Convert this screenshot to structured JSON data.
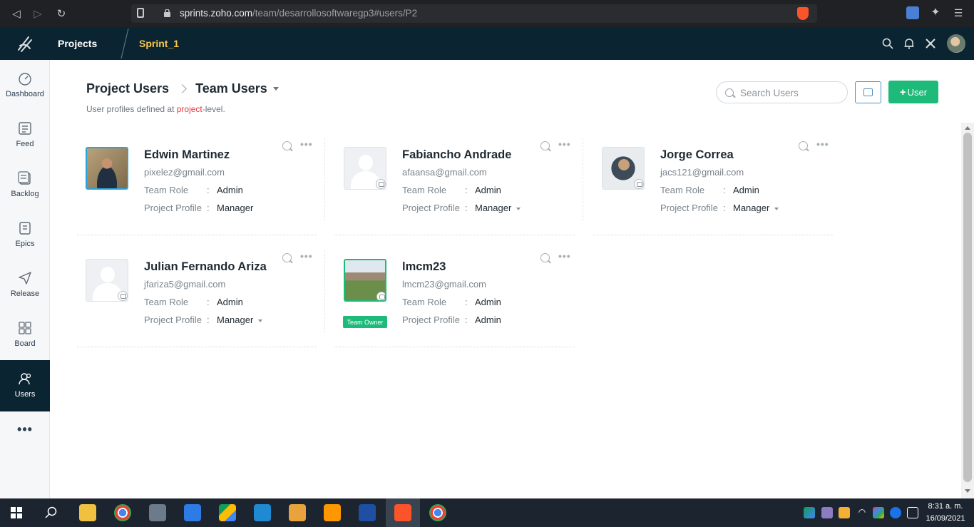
{
  "browser": {
    "url_host": "sprints.zoho.com",
    "url_path": "/team/desarrollosoftwaregp3#users/P2"
  },
  "header": {
    "projects_label": "Projects",
    "sprint_label": "Sprint_1"
  },
  "sidebar": {
    "items": [
      {
        "label": "Dashboard",
        "icon": "dashboard-icon"
      },
      {
        "label": "Feed",
        "icon": "feed-icon"
      },
      {
        "label": "Backlog",
        "icon": "backlog-icon"
      },
      {
        "label": "Epics",
        "icon": "epics-icon"
      },
      {
        "label": "Release",
        "icon": "release-icon"
      },
      {
        "label": "Board",
        "icon": "board-icon"
      },
      {
        "label": "Users",
        "icon": "users-icon",
        "active": true
      }
    ],
    "more": "•••"
  },
  "page": {
    "breadcrumb_1": "Project Users",
    "breadcrumb_2": "Team Users",
    "subtitle_pre": "User profiles defined at ",
    "subtitle_highlight": "project",
    "subtitle_post": "-level.",
    "search_placeholder": "Search Users",
    "add_user_label": "User"
  },
  "labels": {
    "team_role": "Team Role",
    "project_profile": "Project Profile",
    "colon": ":",
    "team_owner": "Team Owner"
  },
  "users": [
    {
      "name": "Edwin Martinez",
      "email": "pixelez@gmail.com",
      "team_role": "Admin",
      "project_profile": "Manager",
      "has_dropdown": false
    },
    {
      "name": "Fabiancho Andrade",
      "email": "afaansa@gmail.com",
      "team_role": "Admin",
      "project_profile": "Manager",
      "has_dropdown": true
    },
    {
      "name": "Jorge Correa",
      "email": "jacs121@gmail.com",
      "team_role": "Admin",
      "project_profile": "Manager",
      "has_dropdown": true
    },
    {
      "name": "Julian Fernando Ariza",
      "email": "jfariza5@gmail.com",
      "team_role": "Admin",
      "project_profile": "Manager",
      "has_dropdown": true
    },
    {
      "name": "lmcm23",
      "email": "lmcm23@gmail.com",
      "team_role": "Admin",
      "project_profile": "Admin",
      "has_dropdown": false,
      "team_owner": true
    }
  ],
  "taskbar": {
    "time": "8:31 a. m.",
    "date": "16/09/2021"
  },
  "colors": {
    "header_bg": "#0b2431",
    "accent_green": "#1dba7a",
    "sprint_yellow": "#f7c948",
    "highlight_red": "#e0393e"
  }
}
